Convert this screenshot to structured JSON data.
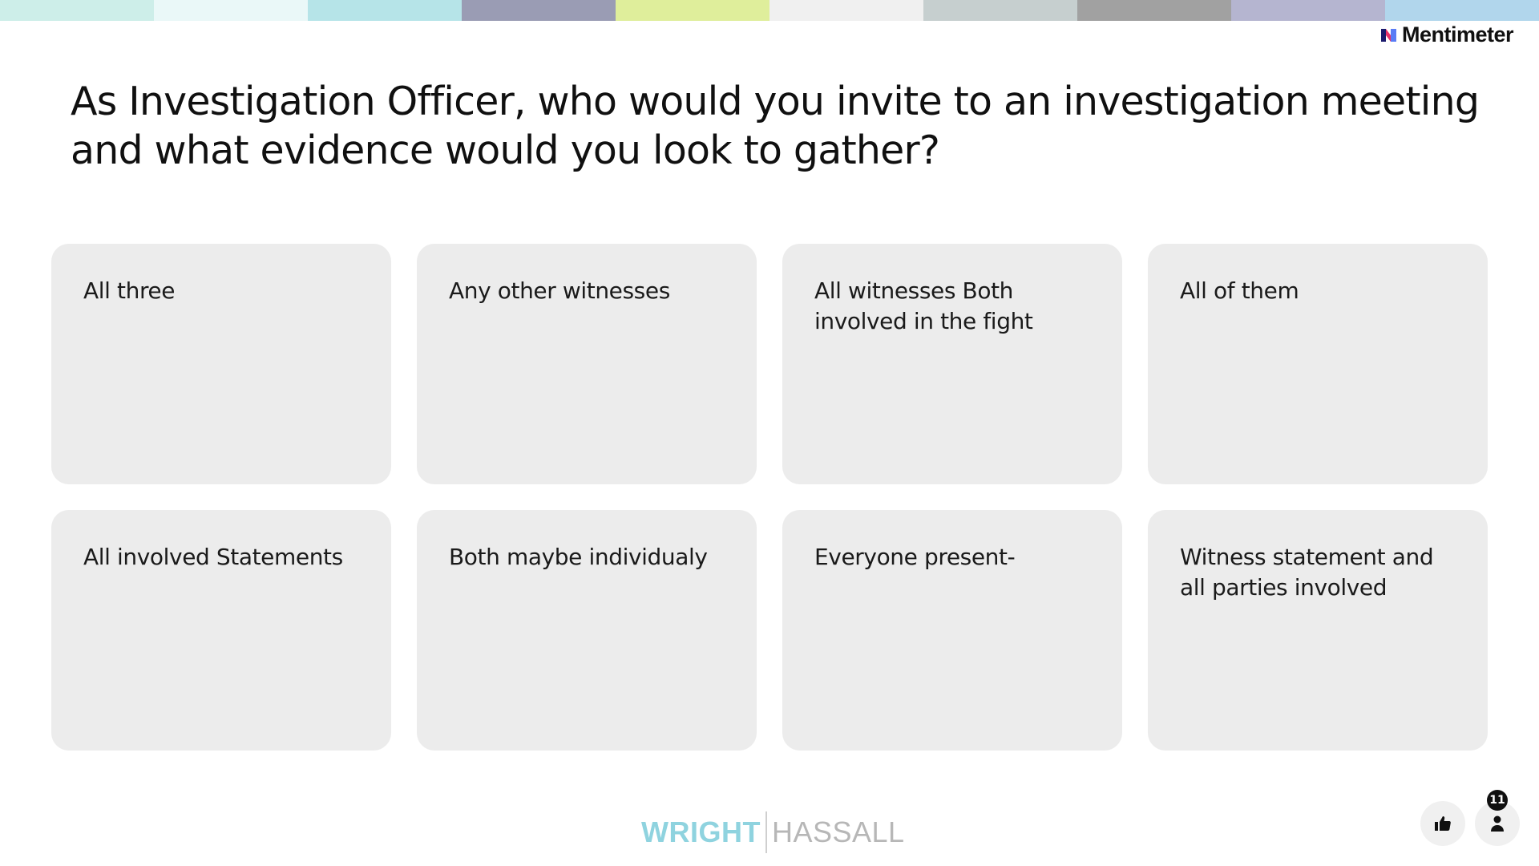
{
  "top_bar_colors": [
    "#cdeee9",
    "#eaf8f8",
    "#b6e4e8",
    "#9a9cb4",
    "#dfee9b",
    "#f0f0f0",
    "#c6cfcf",
    "#a1a1a1",
    "#b5b5d0",
    "#b1d6ec"
  ],
  "brand": {
    "name": "Mentimeter",
    "logo_colors": [
      "#1b1b6e",
      "#e8316b",
      "#5a7cf5"
    ]
  },
  "question": "As Investigation Officer, who would you invite to an investigation meeting and what evidence would you look to gather?",
  "responses": [
    "All three",
    "Any other witnesses",
    "All witnesses Both involved in the fight",
    "All of them",
    "All involved Statements",
    "Both maybe individualy",
    "Everyone present-",
    "Witness statement and all parties involved"
  ],
  "footer": {
    "logo_left": "WRIGHT",
    "logo_right": "HASSALL"
  },
  "controls": {
    "like_icon": "thumbs-up-icon",
    "participants_icon": "person-icon",
    "participant_count": "11"
  },
  "colors": {
    "card_background": "#ececec",
    "text": "#101010",
    "footer_left": "#8fd3df",
    "footer_right": "#b7b7b7"
  }
}
